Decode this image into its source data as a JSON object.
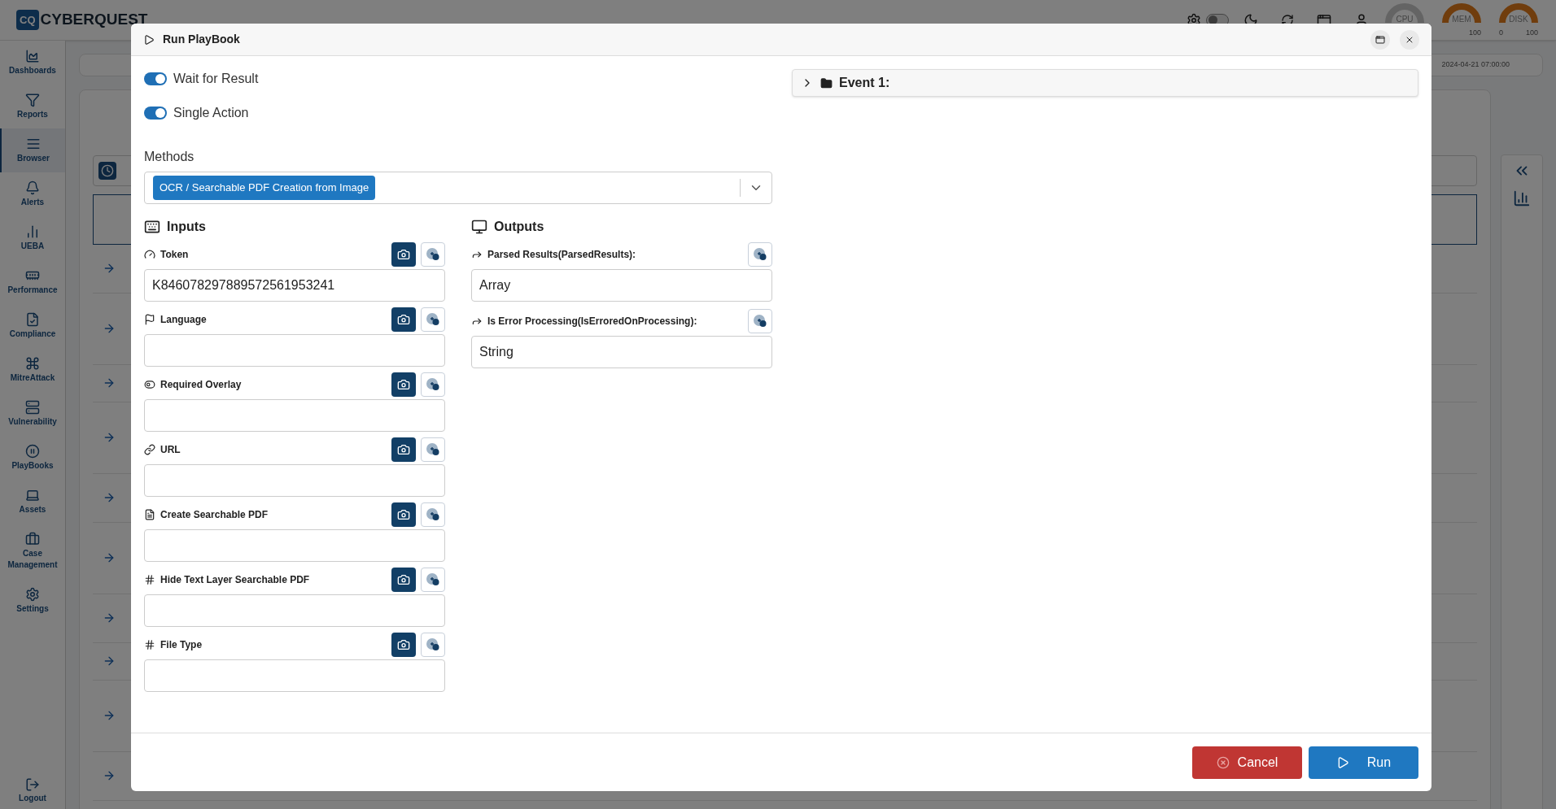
{
  "header": {
    "logo_mark": "CQ",
    "logo_text": "CYBERQUEST",
    "theme_toggle": {
      "on": false
    },
    "gauges": [
      {
        "label": "CPU",
        "color": "#646464"
      },
      {
        "label": "MEM",
        "color": "#703d0d",
        "max": "100"
      },
      {
        "label": "DISK",
        "color": "#703d0d",
        "min": "0",
        "max": "100"
      }
    ],
    "timestamp": "2024-04-21 07:00:00"
  },
  "sidebar": {
    "items": [
      {
        "label": "Dashboards",
        "selected": false
      },
      {
        "label": "Reports",
        "selected": false
      },
      {
        "label": "Browser",
        "selected": true
      },
      {
        "label": "Alerts",
        "selected": false
      },
      {
        "label": "UEBA",
        "selected": false
      },
      {
        "label": "Performance",
        "selected": false
      },
      {
        "label": "Compliance",
        "selected": false
      },
      {
        "label": "MitreAttack",
        "selected": false
      },
      {
        "label": "Vulnerability",
        "selected": false
      },
      {
        "label": "PlayBooks",
        "selected": false
      },
      {
        "label": "Assets",
        "selected": false
      },
      {
        "label": "Case Management",
        "selected": false
      },
      {
        "label": "Settings",
        "selected": false
      }
    ],
    "logout": "Logout"
  },
  "dialog": {
    "title": "Run PlayBook",
    "switches": [
      {
        "label": "Wait for Result",
        "on": true
      },
      {
        "label": "Single Action",
        "on": true
      }
    ],
    "methods": {
      "label": "Methods",
      "selected_tag": "OCR / Searchable PDF Creation from Image"
    },
    "inputs": {
      "title": "Inputs",
      "fields": [
        {
          "label": "Token",
          "value": "K846078297889572561953241"
        },
        {
          "label": "Language"
        },
        {
          "label": "Required Overlay"
        },
        {
          "label": "URL"
        },
        {
          "label": "Create Searchable PDF"
        },
        {
          "label": "Hide Text Layer Searchable PDF"
        },
        {
          "label": "File Type"
        }
      ]
    },
    "outputs": {
      "title": "Outputs",
      "fields": [
        {
          "label": "Parsed Results(ParsedResults):",
          "value": "Array"
        },
        {
          "label": "Is Error Processing(IsErroredOnProcessing):",
          "value": "String"
        }
      ]
    },
    "event": {
      "label": "Event 1:",
      "expanded": false
    },
    "buttons": {
      "cancel": "Cancel",
      "run": "Run"
    }
  }
}
